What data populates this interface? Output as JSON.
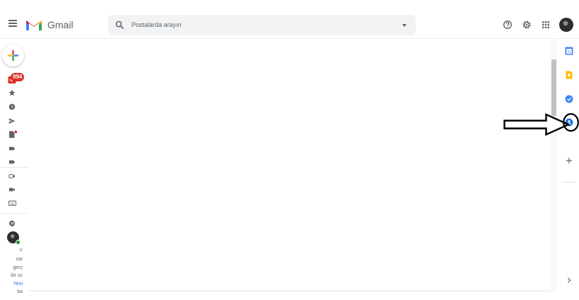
{
  "header": {
    "app_name": "Gmail",
    "search": {
      "placeholder": "Postalarda arayın"
    }
  },
  "left_rail": {
    "inbox_badge": "994",
    "promo_lines": [
      "Y",
      "zaı",
      "gerç",
      "bir sc",
      "Yeni",
      "ba"
    ],
    "promo_link": "Yeni"
  },
  "side_panel": {
    "icons": [
      "calendar-icon",
      "keep-icon",
      "tasks-icon",
      "contacts-icon",
      "add-icon",
      "expand-icon"
    ]
  },
  "colors": {
    "accent_red": "#d93025",
    "keep_yellow": "#fbbc04",
    "google_blue": "#1a73e8",
    "online_green": "#1e8e3e"
  }
}
